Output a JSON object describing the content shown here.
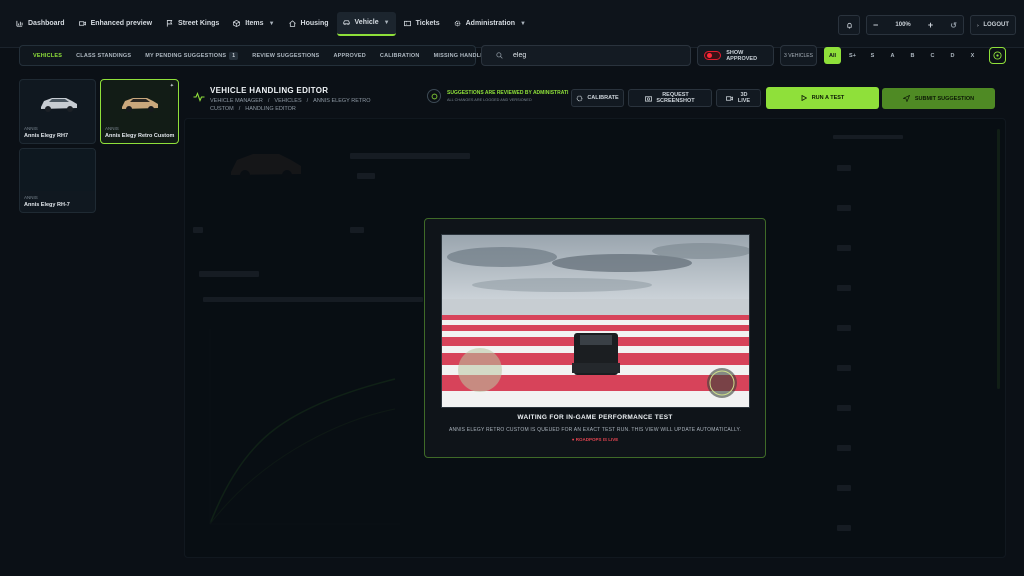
{
  "nav": {
    "items": [
      {
        "label": "Dashboard",
        "icon": "chart-icon"
      },
      {
        "label": "Enhanced preview",
        "icon": "camera-icon"
      },
      {
        "label": "Street Kings",
        "icon": "flag-icon"
      },
      {
        "label": "Items",
        "icon": "box-icon",
        "dropdown": true
      },
      {
        "label": "Housing",
        "icon": "house-icon"
      },
      {
        "label": "Vehicle",
        "icon": "car-icon",
        "dropdown": true,
        "active": true
      },
      {
        "label": "Tickets",
        "icon": "ticket-icon"
      },
      {
        "label": "Administration",
        "icon": "gear-icon",
        "dropdown": true
      }
    ],
    "zoom": "100%",
    "logout_label": "LOGOUT"
  },
  "subnav": {
    "items": [
      {
        "label": "VEHICLES",
        "active": true
      },
      {
        "label": "CLASS STANDINGS"
      },
      {
        "label": "MY PENDING SUGGESTIONS",
        "count": "1"
      },
      {
        "label": "REVIEW SUGGESTIONS"
      },
      {
        "label": "APPROVED"
      },
      {
        "label": "CALIBRATION"
      },
      {
        "label": "MISSING HANDLINGS"
      }
    ]
  },
  "search": {
    "value": "eleg"
  },
  "filters": {
    "show_approved_label": "SHOW APPROVED",
    "vehicle_count": "3 VEHICLES",
    "classes": [
      "All",
      "S+",
      "S",
      "A",
      "B",
      "C",
      "D",
      "X"
    ],
    "active_class": "All"
  },
  "vehicles": [
    {
      "brand": "ANNIS",
      "name": "Annis Elegy RH7"
    },
    {
      "brand": "ANNIS",
      "name": "Annis Elegy Retro Custom",
      "selected": true
    },
    {
      "brand": "ANNIS",
      "name": "Annis Elegy RH-7"
    }
  ],
  "editor": {
    "title": "VEHICLE HANDLING EDITOR",
    "breadcrumb": [
      "VEHICLE MANAGER",
      "VEHICLES",
      "ANNIS ELEGY RETRO CUSTOM",
      "HANDLING EDITOR"
    ],
    "review_title": "SUGGESTIONS ARE REVIEWED BY ADMINISTRATI",
    "review_sub": "ALL CHANGES ARE LOGGED AND VERSIONED",
    "calibrate_label": "CALIBRATE",
    "request_screenshot_label": "REQUEST SCREENSHOT",
    "live_label": "3D LIVE",
    "run_test_label": "RUN A TEST",
    "submit_label": "SUBMIT SUGGESTION"
  },
  "modal": {
    "title": "WAITING FOR IN-GAME PERFORMANCE TEST",
    "description": "ANNIS ELEGY RETRO CUSTOM IS QUEUED FOR AN EXACT TEST RUN. THIS VIEW WILL UPDATE AUTOMATICALLY.",
    "live_status": "ROADPOPS IS LIVE"
  },
  "colors": {
    "accent": "#8fe03a",
    "accent_dark": "#4f8a24",
    "danger": "#e11d2e",
    "bg": "#0b1016"
  }
}
